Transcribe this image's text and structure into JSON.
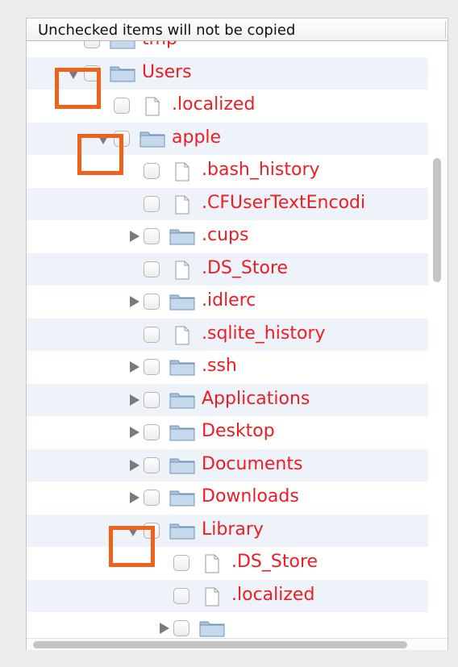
{
  "header": {
    "label": "Unchecked items will not be copied"
  },
  "rows": [
    {
      "label": "tmp",
      "type": "folder",
      "depth": 0,
      "disclosure": "none"
    },
    {
      "label": "Users",
      "type": "folder",
      "depth": 0,
      "disclosure": "open"
    },
    {
      "label": ".localized",
      "type": "file",
      "depth": 1,
      "disclosure": "none"
    },
    {
      "label": "apple",
      "type": "folder",
      "depth": 1,
      "disclosure": "open"
    },
    {
      "label": ".bash_history",
      "type": "file",
      "depth": 2,
      "disclosure": "none"
    },
    {
      "label": ".CFUserTextEncodi",
      "type": "file",
      "depth": 2,
      "disclosure": "none"
    },
    {
      "label": ".cups",
      "type": "folder",
      "depth": 2,
      "disclosure": "closed"
    },
    {
      "label": ".DS_Store",
      "type": "file",
      "depth": 2,
      "disclosure": "none"
    },
    {
      "label": ".idlerc",
      "type": "folder",
      "depth": 2,
      "disclosure": "closed"
    },
    {
      "label": ".sqlite_history",
      "type": "file",
      "depth": 2,
      "disclosure": "none"
    },
    {
      "label": ".ssh",
      "type": "folder",
      "depth": 2,
      "disclosure": "closed"
    },
    {
      "label": "Applications",
      "type": "folder",
      "depth": 2,
      "disclosure": "closed"
    },
    {
      "label": "Desktop",
      "type": "folder",
      "depth": 2,
      "disclosure": "closed"
    },
    {
      "label": "Documents",
      "type": "folder",
      "depth": 2,
      "disclosure": "closed"
    },
    {
      "label": "Downloads",
      "type": "folder",
      "depth": 2,
      "disclosure": "closed"
    },
    {
      "label": "Library",
      "type": "folder",
      "depth": 2,
      "disclosure": "open"
    },
    {
      "label": ".DS_Store",
      "type": "file",
      "depth": 3,
      "disclosure": "none"
    },
    {
      "label": ".localized",
      "type": "file",
      "depth": 3,
      "disclosure": "none"
    },
    {
      "label": "",
      "type": "folder",
      "depth": 3,
      "disclosure": "closed"
    }
  ],
  "colors": {
    "label": "#ee1d24",
    "highlight": "#f0611c",
    "alt_row": "#eef3fa",
    "folder": "#8fb3d4"
  }
}
